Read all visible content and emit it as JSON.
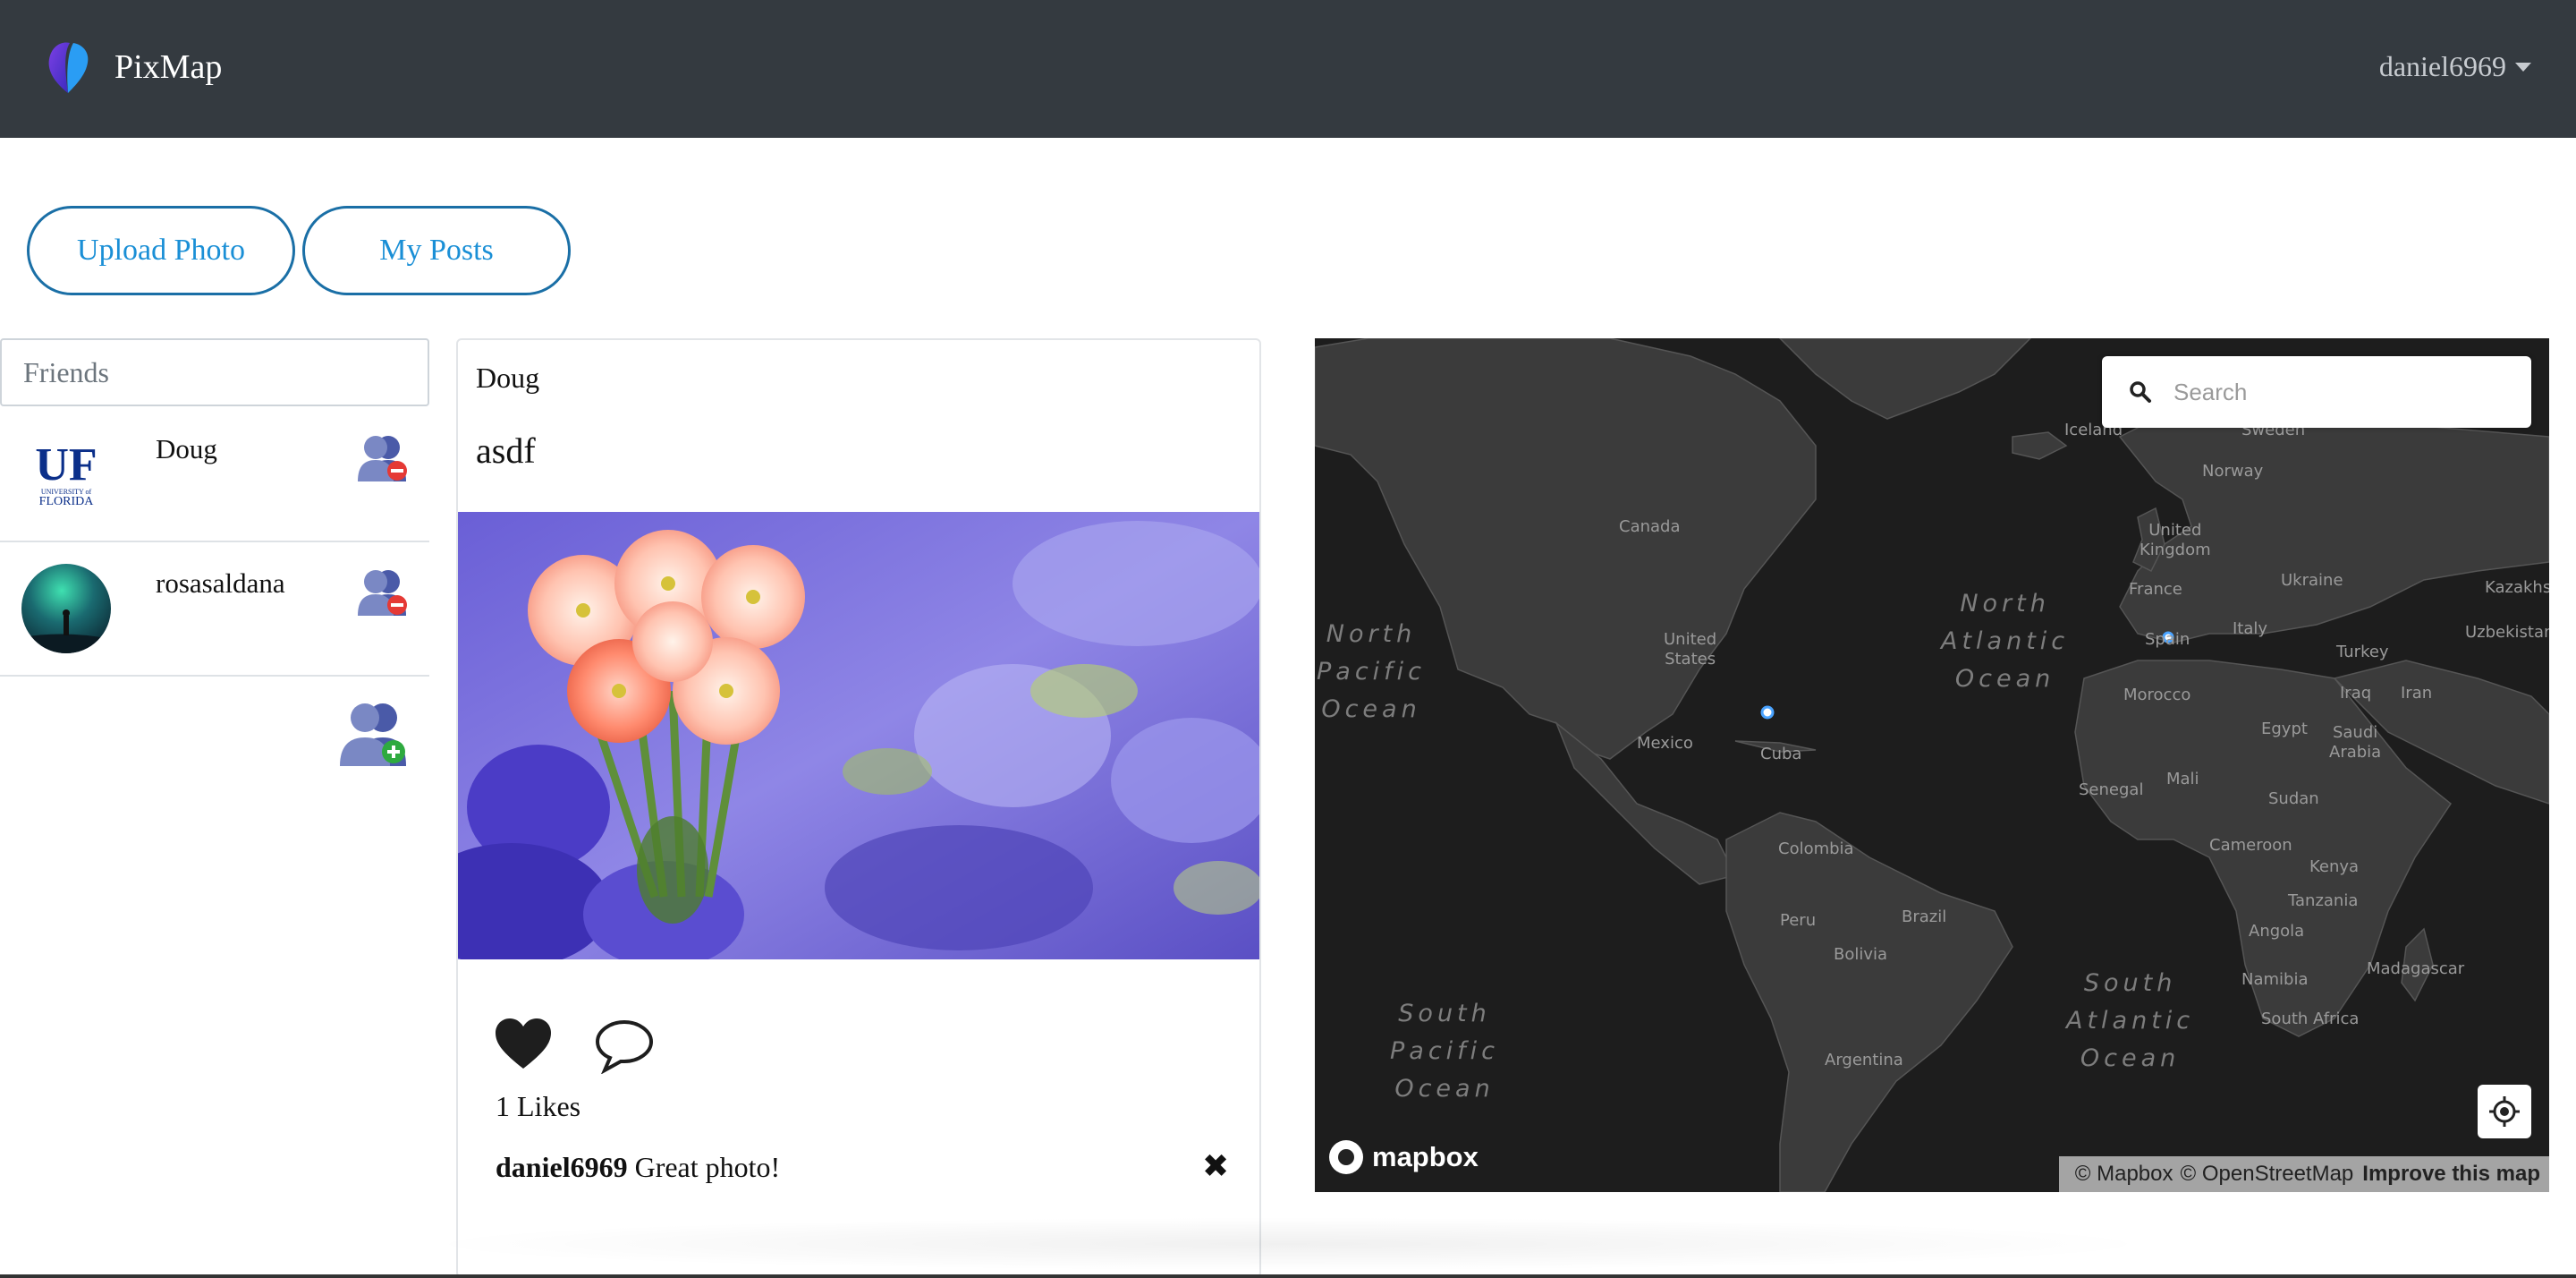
{
  "navbar": {
    "brand": "PixMap",
    "user": "daniel6969",
    "logo_icon": "pixmap-logo-icon",
    "caret_icon": "caret-down-icon"
  },
  "actions": {
    "upload_label": "Upload Photo",
    "posts_label": "My Posts"
  },
  "friends": {
    "header": "Friends",
    "items": [
      {
        "name": "Doug",
        "avatar": "uf-logo-avatar",
        "action_icon": "remove-friend-icon"
      },
      {
        "name": "rosasaldana",
        "avatar": "aurora-avatar",
        "action_icon": "remove-friend-icon"
      }
    ],
    "add_icon": "add-friend-icon",
    "uf_logo": {
      "letters": "UF",
      "line1": "UNIVERSITY of",
      "line2": "FLORIDA"
    }
  },
  "post": {
    "author": "Doug",
    "caption": "asdf",
    "image": "primrose-flowers-photo",
    "likes": "1 Likes",
    "comments": [
      {
        "user": "daniel6969",
        "text": " Great photo!"
      }
    ],
    "like_icon": "heart-icon",
    "comment_icon": "speech-bubble-icon",
    "delete_icon": "close-icon",
    "delete_glyph": "✖"
  },
  "map": {
    "search_placeholder": "Search",
    "countries": {
      "iceland": "Iceland",
      "sweden": "Sweden",
      "norway": "Norway",
      "canada": "Canada",
      "uk": "United\nKingdom",
      "france": "France",
      "ukraine": "Ukraine",
      "kazakhstan": "Kazakhs",
      "us": "United\nStates",
      "spain": "Spain",
      "italy": "Italy",
      "uzbekistan": "Uzbekistan",
      "turkey": "Turkey",
      "morocco": "Morocco",
      "iraq": "Iraq",
      "iran": "Iran",
      "egypt": "Egypt",
      "saudi": "Saudi\nArabia",
      "mexico": "Mexico",
      "cuba": "Cuba",
      "senegal": "Senegal",
      "mali": "Mali",
      "sudan": "Sudan",
      "cameroon": "Cameroon",
      "kenya": "Kenya",
      "colombia": "Colombia",
      "tanzania": "Tanzania",
      "peru": "Peru",
      "brazil": "Brazil",
      "bolivia": "Bolivia",
      "angola": "Angola",
      "namibia": "Namibia",
      "madagascar": "Madagascar",
      "south_africa": "South Africa",
      "argentina": "Argentina"
    },
    "oceans": {
      "north_atlantic": "North\nAtlantic\nOcean",
      "north_pacific": "North\nPacific\nOcean",
      "south_pacific": "South\nPacific\nOcean",
      "south_atlantic": "South\nAtlantic\nOcean"
    },
    "logo": "mapbox",
    "attribution": {
      "mapbox": "© Mapbox",
      "osm": "© OpenStreetMap",
      "improve": "Improve this map"
    },
    "search_icon": "search-icon",
    "geolocate_icon": "geolocate-icon"
  }
}
